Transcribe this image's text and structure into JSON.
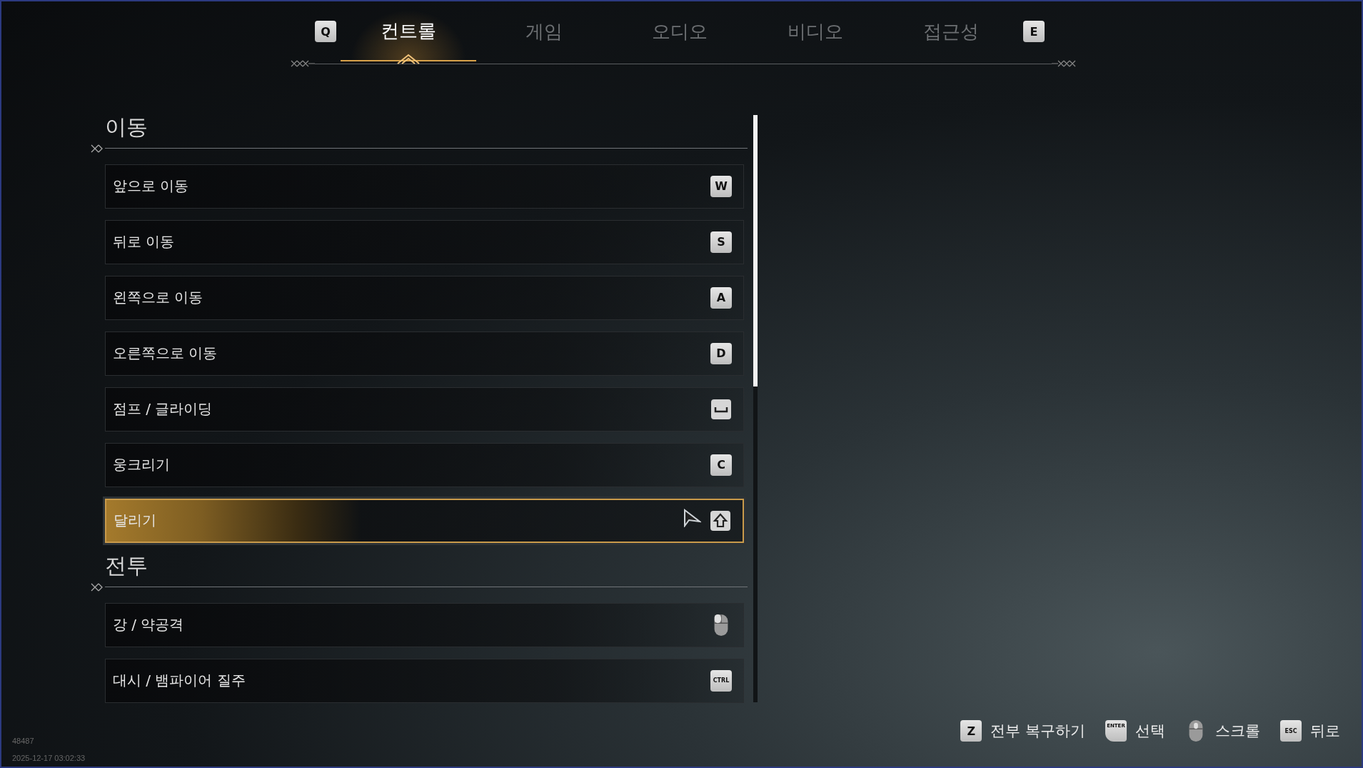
{
  "tabs": {
    "prev_key": "Q",
    "next_key": "E",
    "items": [
      {
        "label": "컨트롤",
        "selected": true
      },
      {
        "label": "게임",
        "selected": false
      },
      {
        "label": "오디오",
        "selected": false
      },
      {
        "label": "비디오",
        "selected": false
      },
      {
        "label": "접근성",
        "selected": false
      }
    ]
  },
  "sections": [
    {
      "title": "이동",
      "rows": [
        {
          "label": "앞으로 이동",
          "key": {
            "kind": "key",
            "text": "W"
          },
          "selected": false
        },
        {
          "label": "뒤로 이동",
          "key": {
            "kind": "key",
            "text": "S"
          },
          "selected": false
        },
        {
          "label": "왼쪽으로 이동",
          "key": {
            "kind": "key",
            "text": "A"
          },
          "selected": false
        },
        {
          "label": "오른쪽으로 이동",
          "key": {
            "kind": "key",
            "text": "D"
          },
          "selected": false
        },
        {
          "label": "점프 / 글라이딩",
          "key": {
            "kind": "space"
          },
          "selected": false
        },
        {
          "label": "웅크리기",
          "key": {
            "kind": "key",
            "text": "C"
          },
          "selected": false
        },
        {
          "label": "달리기",
          "key": {
            "kind": "shift"
          },
          "selected": true
        }
      ]
    },
    {
      "title": "전투",
      "rows": [
        {
          "label": "강 / 약공격",
          "key": {
            "kind": "mouse"
          },
          "selected": false
        },
        {
          "label": "대시 / 뱀파이어 질주",
          "key": {
            "kind": "small",
            "text": "CTRL"
          },
          "selected": false
        }
      ]
    }
  ],
  "hints": [
    {
      "key": {
        "kind": "key",
        "text": "Z"
      },
      "label": "전부 복구하기"
    },
    {
      "key": {
        "kind": "enter",
        "text": "ENTER"
      },
      "label": "선택"
    },
    {
      "key": {
        "kind": "mouse"
      },
      "label": "스크롤"
    },
    {
      "key": {
        "kind": "small",
        "text": "ESC"
      },
      "label": "뒤로"
    }
  ],
  "build_number": "48487",
  "timestamp": "2025-12-17 03:02:33"
}
